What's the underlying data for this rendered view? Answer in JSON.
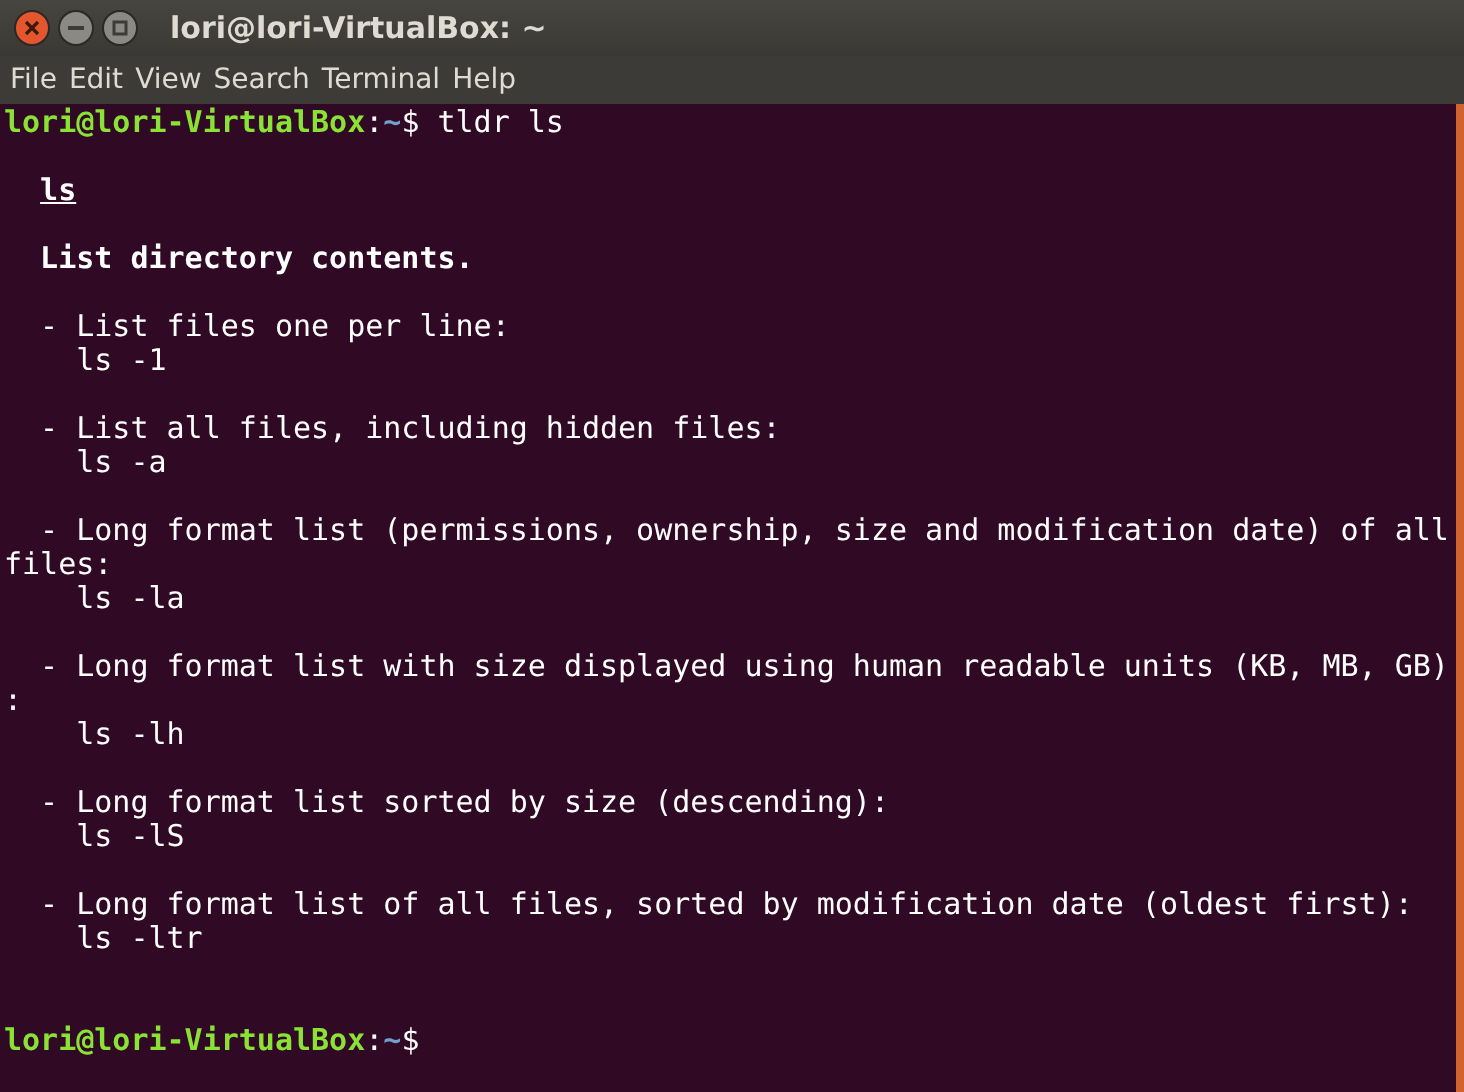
{
  "window": {
    "title": "lori@lori-VirtualBox: ~"
  },
  "menu": [
    "File",
    "Edit",
    "View",
    "Search",
    "Terminal",
    "Help"
  ],
  "terminal": {
    "prompt": {
      "user_host": "lori@lori-VirtualBox",
      "separator": ":",
      "path": "~",
      "symbol": "$",
      "command": "tldr ls"
    },
    "heading": "ls",
    "summary": "List directory contents.",
    "examples": [
      {
        "description": [
          "- List files one per line:"
        ],
        "command": "ls -1"
      },
      {
        "description": [
          "- List all files, including hidden files:"
        ],
        "command": "ls -a"
      },
      {
        "description": [
          "- Long format list (permissions, ownership, size and modification date) of all",
          "files:"
        ],
        "command": "ls -la"
      },
      {
        "description": [
          "- Long format list with size displayed using human readable units (KB, MB, GB)",
          ":"
        ],
        "command": "ls -lh"
      },
      {
        "description": [
          "- Long format list sorted by size (descending):"
        ],
        "command": "ls -lS"
      },
      {
        "description": [
          "- Long format list of all files, sorted by modification date (oldest first):"
        ],
        "command": "ls -ltr"
      }
    ],
    "final_prompt": {
      "user_host": "lori@lori-VirtualBox",
      "separator": ":",
      "path": "~",
      "symbol": "$"
    }
  }
}
